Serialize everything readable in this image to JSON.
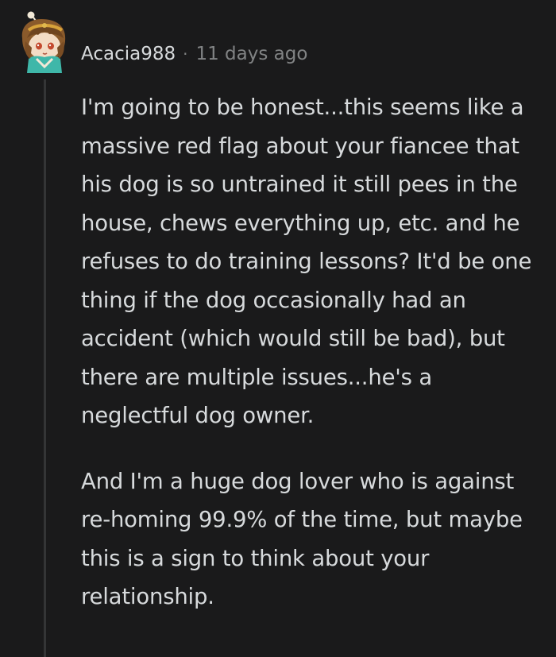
{
  "comment": {
    "author": "Acacia988",
    "separator": "·",
    "timestamp": "11 days ago",
    "avatar_icon": "anime-character-avatar",
    "paragraphs": [
      "I'm going to be honest...this seems like a massive red flag about your fiancee that his dog is so untrained it still pees in the house, chews everything up, etc. and he refuses to do training lessons? It'd be one thing if the dog occasionally had an accident (which would still be bad), but there are multiple issues...he's a neglectful dog owner.",
      "And I'm a huge dog lover who is against re-homing 99.9% of the time, but maybe this is a sign to think about your relationship."
    ]
  },
  "colors": {
    "background": "#1a1a1b",
    "text": "#d7dadc",
    "muted": "#818384",
    "thread_line": "#343536"
  }
}
